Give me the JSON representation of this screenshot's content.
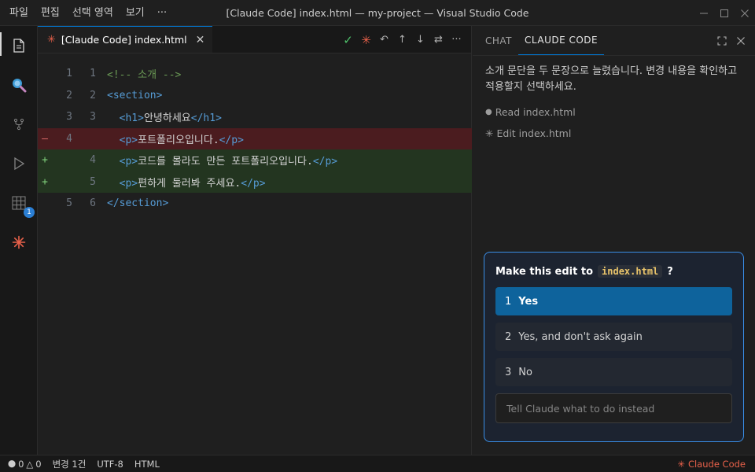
{
  "titlebar": {
    "menus": [
      "파일",
      "편집",
      "선택 영역",
      "보기",
      "···"
    ],
    "title": "[Claude Code] index.html — my-project — Visual Studio Code"
  },
  "activity": {
    "badge_count": "1"
  },
  "editor": {
    "tab_label": "[Claude Code] index.html",
    "lines": [
      {
        "kind": "context",
        "old": "1",
        "new": "1",
        "mark": ""
      },
      {
        "kind": "context",
        "old": "2",
        "new": "2",
        "mark": ""
      },
      {
        "kind": "context",
        "old": "3",
        "new": "3",
        "mark": ""
      },
      {
        "kind": "removed",
        "old": "4",
        "new": "",
        "mark": "–"
      },
      {
        "kind": "added",
        "old": "",
        "new": "4",
        "mark": "+"
      },
      {
        "kind": "added",
        "old": "",
        "new": "5",
        "mark": "+"
      },
      {
        "kind": "context",
        "old": "5",
        "new": "6",
        "mark": ""
      }
    ],
    "code": {
      "l1_comment": "<!-- 소개 -->",
      "l2_tag": "<section>",
      "l3_open": "<h1>",
      "l3_text": "안녕하세요",
      "l3_close": "</h1>",
      "l4_open": "<p>",
      "l4_text": "포트폴리오입니다.",
      "l4_close": "</p>",
      "l5_open": "<p>",
      "l5_text": "코드를 몰라도 만든 포트폴리오입니다.",
      "l5_close": "</p>",
      "l6_open": "<p>",
      "l6_text": "편하게 둘러봐 주세요.",
      "l6_close": "</p>",
      "l7_tag": "</section>"
    }
  },
  "panel": {
    "tabs": [
      "CHAT",
      "CLAUDE CODE"
    ],
    "message": "소개 문단을 두 문장으로 늘렸습니다. 변경 내용을 확인하고 적용할지 선택하세요.",
    "steps": [
      "Read index.html",
      "Edit index.html"
    ],
    "dialog": {
      "question_prefix": "Make this edit to",
      "file": "index.html",
      "question_suffix": "?",
      "options": [
        {
          "num": "1",
          "label": "Yes"
        },
        {
          "num": "2",
          "label": "Yes, and don't ask again"
        },
        {
          "num": "3",
          "label": "No"
        }
      ],
      "input_placeholder": "Tell Claude what to do instead"
    }
  },
  "statusbar": {
    "errors": "0",
    "warnings": "0",
    "changes": "변경 1건",
    "encoding": "UTF-8",
    "language": "HTML",
    "right_label": "Claude Code"
  },
  "colors": {
    "accent": "#0078d4",
    "claude_orange": "#e8614a",
    "removed_bg": "#4b1c1f",
    "added_bg": "#233520"
  }
}
